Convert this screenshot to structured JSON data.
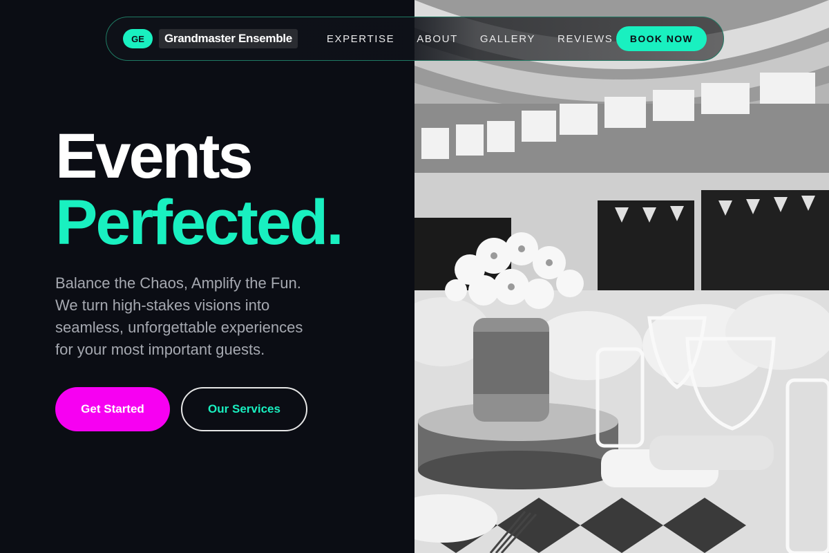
{
  "brand": {
    "badge": "GE",
    "name": "Grandmaster Ensemble"
  },
  "nav": {
    "links": [
      "EXPERTISE",
      "ABOUT",
      "GALLERY",
      "REVIEWS"
    ],
    "cta": "BOOK NOW"
  },
  "hero": {
    "headline_line1": "Events",
    "headline_line2": "Perfected.",
    "subtitle_lines": [
      "Balance the Chaos, Amplify the Fun.",
      "We turn high-stakes visions into",
      "seamless, unforgettable experiences",
      "for your most important guests."
    ],
    "primary_button": "Get Started",
    "secondary_button": "Our Services"
  },
  "colors": {
    "background": "#0b0d14",
    "accent": "#19f0c0",
    "primary_button": "#f700f2",
    "text_muted": "#a6a9b1"
  },
  "icons": {
    "hero_image": "event-table-setting-photo"
  }
}
